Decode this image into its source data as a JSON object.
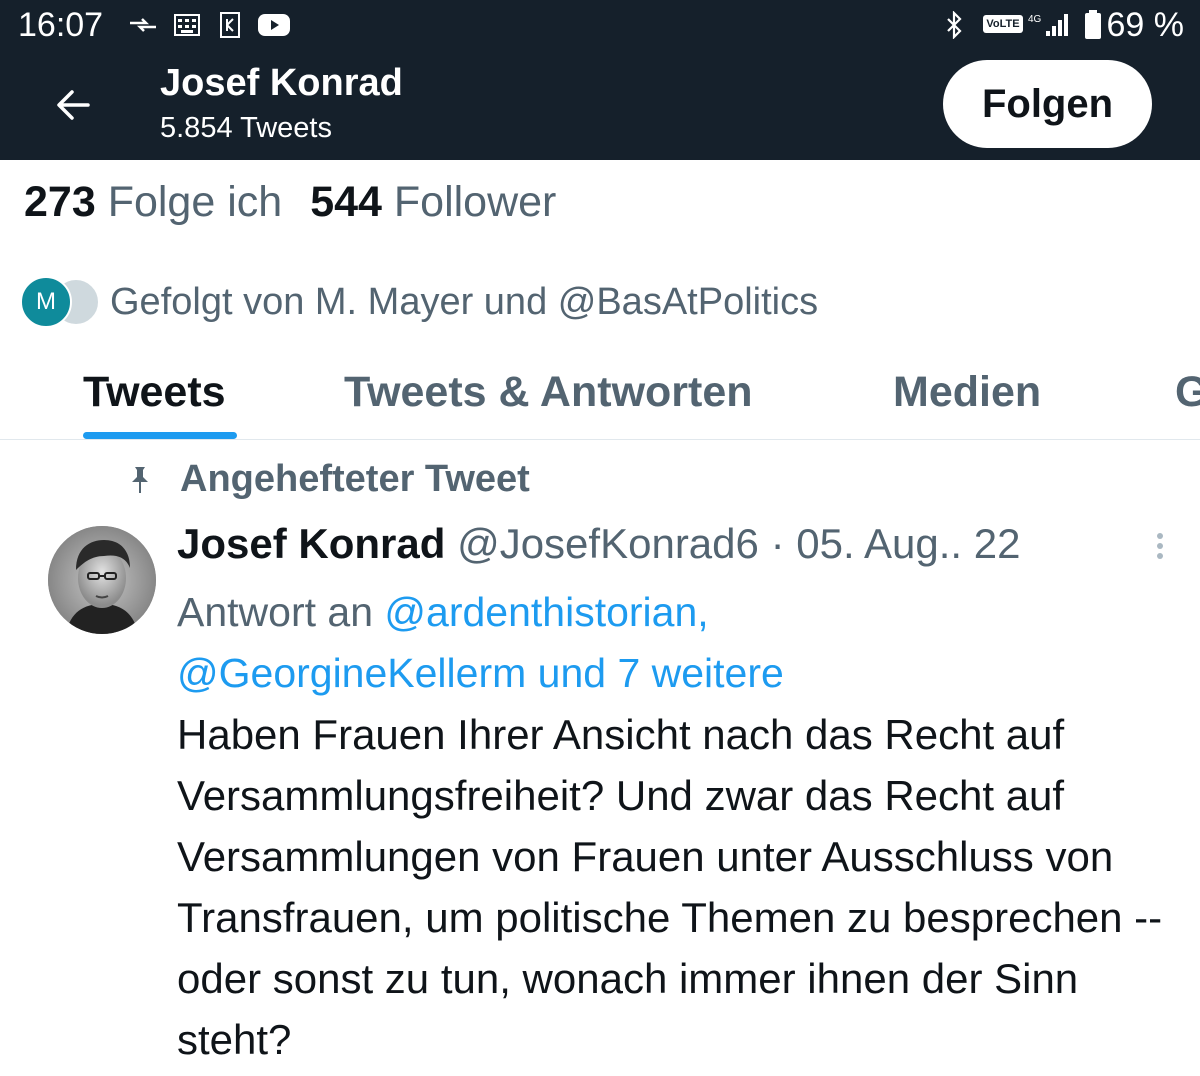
{
  "status_bar": {
    "time": "16:07",
    "network": "VoLTE",
    "signal_label": "4G",
    "battery": "69 %"
  },
  "header": {
    "name": "Josef Konrad",
    "tweet_count": "5.854 Tweets",
    "follow_label": "Folgen"
  },
  "stats": {
    "following_count": "273",
    "following_label": "Folge ich",
    "followers_count": "544",
    "followers_label": "Follower"
  },
  "followed_by": {
    "avatar_letter": "M",
    "text": "Gefolgt von M. Mayer und @BasAtPolitics"
  },
  "tabs": [
    {
      "label": "Tweets"
    },
    {
      "label": "Tweets & Antworten"
    },
    {
      "label": "Medien"
    },
    {
      "label": "G"
    }
  ],
  "pinned": {
    "label": "Angehefteter Tweet"
  },
  "tweet": {
    "name": "Josef Konrad",
    "handle": "@JosefKonrad6",
    "separator": "·",
    "date": "05. Aug.. 22",
    "reply_prefix": "Antwort an",
    "reply_link1": "@ardenthistorian,",
    "reply_link2": "@GeorgineKellerm und 7 weitere",
    "text": "Haben Frauen Ihrer Ansicht nach das Recht auf Versammlungsfreiheit? Und zwar das Recht auf Versammlungen von Frauen unter Ausschluss von Transfrauen, um politische Themen zu besprechen -- oder sonst zu tun, wonach immer ihnen der Sinn steht?"
  },
  "colors": {
    "header_bg": "#15202b",
    "accent": "#1d9bf0",
    "muted_text": "#536471"
  }
}
